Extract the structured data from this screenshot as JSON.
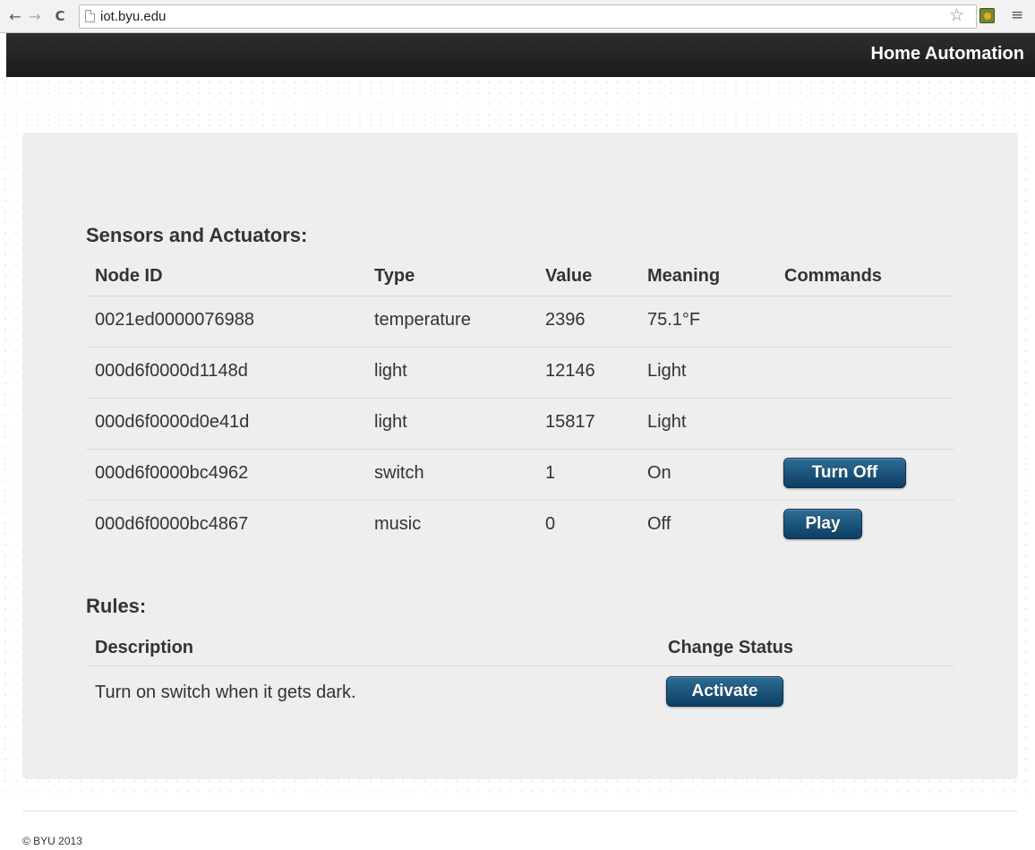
{
  "browser": {
    "back_glyph": "←",
    "forward_glyph": "→",
    "reload_glyph": "C",
    "url": "iot.byu.edu",
    "star_glyph": "☆",
    "menu_glyph": "≡"
  },
  "navbar": {
    "brand": "Home Automation"
  },
  "sensors": {
    "title": "Sensors and Actuators:",
    "headers": [
      "Node ID",
      "Type",
      "Value",
      "Meaning",
      "Commands"
    ],
    "rows": [
      {
        "node_id": "0021ed0000076988",
        "type": "temperature",
        "value": "2396",
        "meaning": "75.1°F",
        "command": ""
      },
      {
        "node_id": "000d6f0000d1148d",
        "type": "light",
        "value": "12146",
        "meaning": "Light",
        "command": ""
      },
      {
        "node_id": "000d6f0000d0e41d",
        "type": "light",
        "value": "15817",
        "meaning": "Light",
        "command": ""
      },
      {
        "node_id": "000d6f0000bc4962",
        "type": "switch",
        "value": "1",
        "meaning": "On",
        "command": "Turn Off"
      },
      {
        "node_id": "000d6f0000bc4867",
        "type": "music",
        "value": "0",
        "meaning": "Off",
        "command": "Play"
      }
    ]
  },
  "rules": {
    "title": "Rules:",
    "headers": [
      "Description",
      "Change Status"
    ],
    "rows": [
      {
        "description": "Turn on switch when it gets dark.",
        "action": "Activate"
      }
    ]
  },
  "footer": {
    "text": "© BYU 2013"
  },
  "colors": {
    "navbar": "#1f1f1f",
    "button": "#134a70",
    "well": "#eeeeee"
  }
}
